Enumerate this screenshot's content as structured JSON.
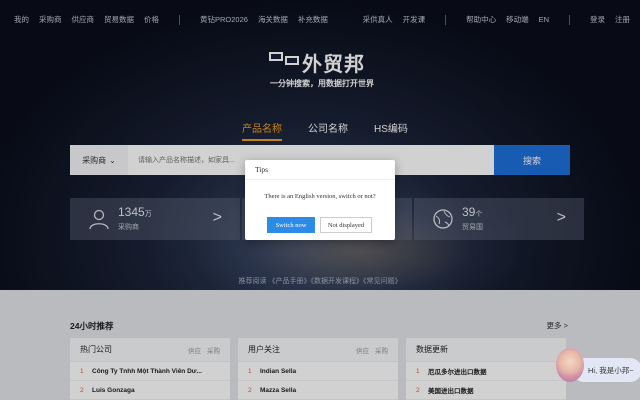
{
  "topnav": {
    "left": [
      "我的",
      "采购商",
      "供应商",
      "贸易数据",
      "价格"
    ],
    "mid": [
      "黄钻PRO2026",
      "海关数据",
      "补充数据"
    ],
    "right_a": [
      "采供真人",
      "开发课"
    ],
    "right_b": [
      "帮助中心",
      "移动端",
      "EN"
    ],
    "right_c": [
      "登录",
      "注册"
    ]
  },
  "brand": {
    "name": "外贸邦",
    "slogan": "一分钟搜索，用数据打开世界"
  },
  "tabs": [
    "产品名称",
    "公司名称",
    "HS编码"
  ],
  "search": {
    "select_label": "采购商",
    "placeholder": "请输入产品名称描述，如家具...",
    "button": "搜索"
  },
  "stats": [
    {
      "number": "1345",
      "unit": "万",
      "label": "采购商"
    },
    {
      "number": "",
      "unit": "",
      "label": ""
    },
    {
      "number": "39",
      "unit": "个",
      "label": "贸易国"
    }
  ],
  "links_text": "推荐阅读 《产品手册》《数据开发课程》《常见问题》",
  "section": {
    "title": "24小时推荐",
    "more": "更多 >",
    "cards": [
      {
        "title": "热门公司",
        "meta": [
          "供应",
          "采购"
        ],
        "rows": [
          "Công Ty Tnhh Một Thành Viên Dư...",
          "Luis Gonzaga"
        ]
      },
      {
        "title": "用户关注",
        "meta": [
          "供应",
          "采购"
        ],
        "rows": [
          "Indian Sella",
          "Mazza Sella"
        ]
      },
      {
        "title": "数据更新",
        "meta": [],
        "rows": [
          "厄瓜多尔进出口数据",
          "美国进出口数据"
        ]
      }
    ]
  },
  "modal": {
    "title": "Tips",
    "message": "There is an English version, switch or not?",
    "confirm": "Switch now",
    "cancel": "Not displayed"
  },
  "chat": {
    "text": "Hi, 我是小邦~"
  }
}
